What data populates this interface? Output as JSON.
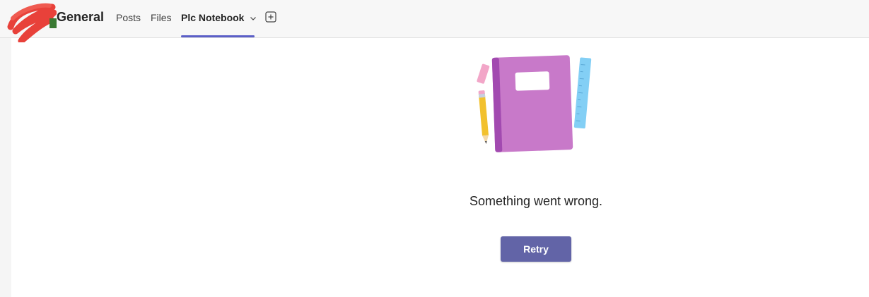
{
  "header": {
    "channel_title": "General",
    "tabs": [
      {
        "label": "Posts"
      },
      {
        "label": "Files"
      },
      {
        "label": "Plc Notebook",
        "active": true
      }
    ],
    "add_tab_icon": "plus-square-icon",
    "dropdown_icon": "chevron-down-icon"
  },
  "main": {
    "error_message": "Something went wrong.",
    "retry_label": "Retry",
    "illustration_icon": "notebook-illustration"
  },
  "colors": {
    "accent": "#5b5fc7",
    "button": "#6264a7",
    "notebook": "#c879c9",
    "notebook_spine": "#a24ab0",
    "ruler": "#83cff5",
    "pencil": "#f2c12e"
  }
}
